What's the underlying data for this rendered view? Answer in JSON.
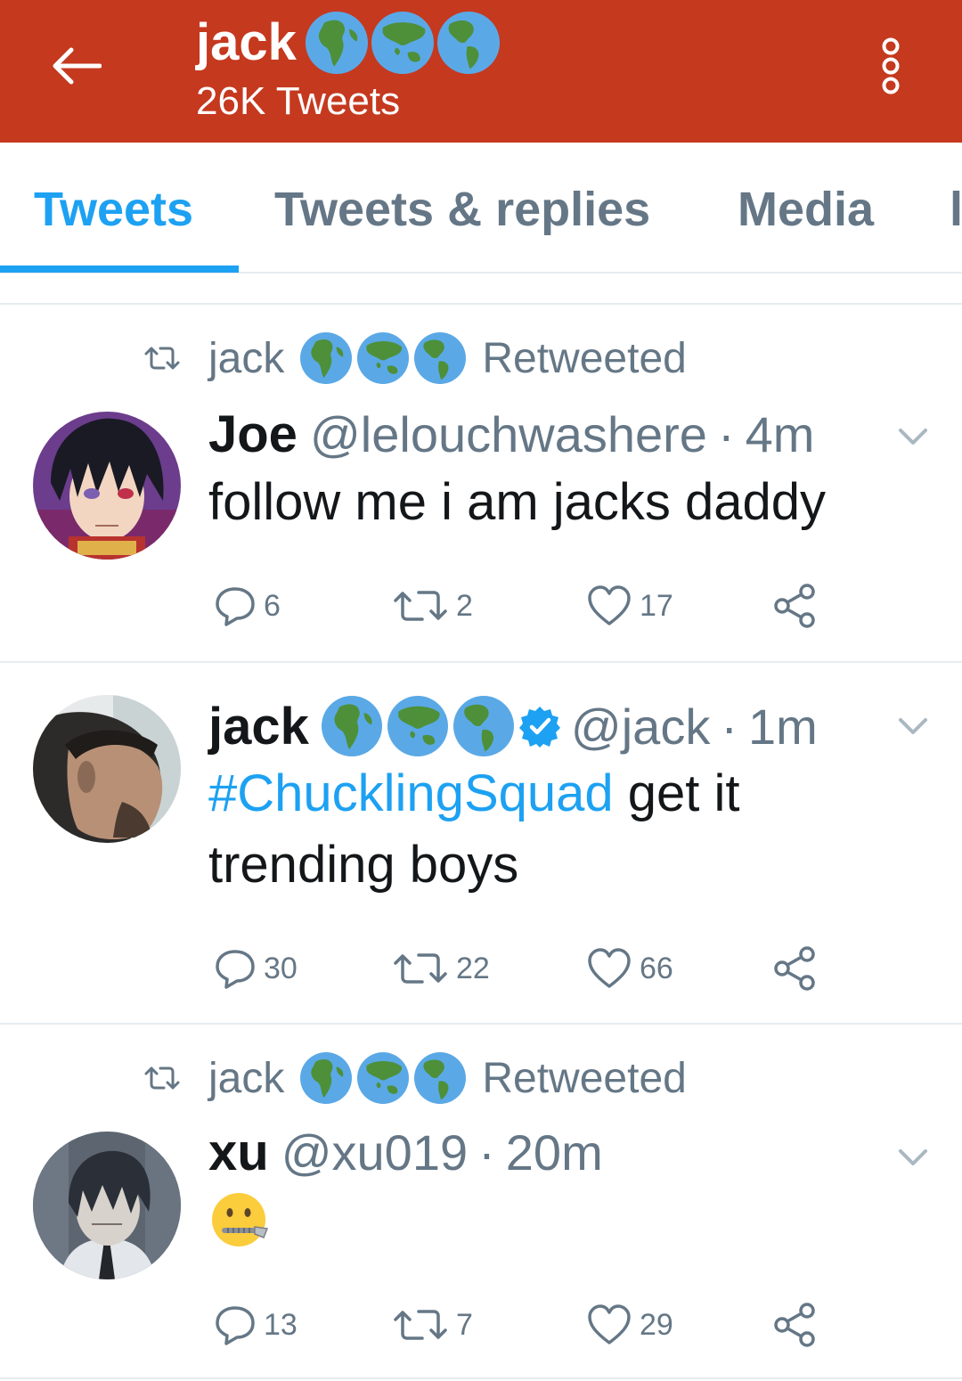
{
  "header": {
    "back_icon": "arrow-left-icon",
    "name": "jack",
    "name_emojis": [
      "globe-africa-icon",
      "globe-asia-icon",
      "globe-americas-icon"
    ],
    "tweet_count": "26K Tweets",
    "more_icon": "vertical-dots-icon",
    "bg_color": "#c5391f"
  },
  "tabs": [
    {
      "label": "Tweets",
      "active": true
    },
    {
      "label": "Tweets & replies",
      "active": false
    },
    {
      "label": "Media",
      "active": false
    },
    {
      "label": "l",
      "active": false
    }
  ],
  "tweets": [
    {
      "retweeted_by": "jack",
      "retweeted_label": "Retweeted",
      "display_name": "Joe",
      "handle": "@lelouchwashere",
      "separator": "·",
      "time": "4m",
      "text": "follow me i am jacks daddy",
      "replies": "6",
      "retweets": "2",
      "likes": "17"
    },
    {
      "display_name": "jack",
      "verified": true,
      "handle": "@jack",
      "separator": "·",
      "time": "1m",
      "hashtag": "#ChucklingSquad",
      "text": " get it trending boys",
      "replies": "30",
      "retweets": "22",
      "likes": "66"
    },
    {
      "retweeted_by": "jack",
      "retweeted_label": "Retweeted",
      "display_name": "xu",
      "handle": "@xu019",
      "separator": "·",
      "time": "20m",
      "emoji": "zipper-mouth-face-icon",
      "replies": "13",
      "retweets": "7",
      "likes": "29"
    }
  ],
  "colors": {
    "accent": "#1da1f2",
    "muted": "#657786",
    "text": "#14171a"
  }
}
